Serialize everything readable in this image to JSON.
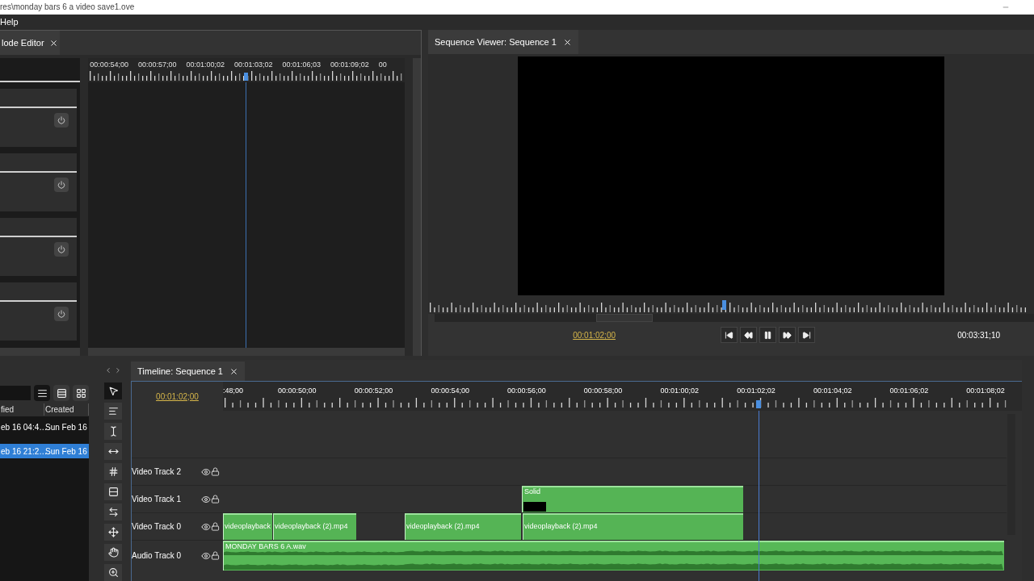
{
  "window": {
    "title": "res\\monday bars 6 a video save1.ove"
  },
  "menu": [
    {
      "label": "Help"
    }
  ],
  "node_editor": {
    "tab": "lode Editor",
    "playhead": {
      "level": 0.5
    },
    "nodes": [
      {
        "kind": "effect"
      },
      {
        "kind": "effect"
      },
      {
        "kind": "effect"
      },
      {
        "kind": "effect"
      }
    ],
    "ruler": [
      "00:00:54;00",
      "00:00:57;00",
      "00:01:00;02",
      "00:01:03;02",
      "00:01:06;03",
      "00:01:09;02",
      "00"
    ]
  },
  "viewer": {
    "tab": "Sequence Viewer: Sequence 1",
    "current_time": "00:01:02;00",
    "duration": "00:03:31;10",
    "transport": [
      {
        "kind": "first"
      },
      {
        "kind": "rewind"
      },
      {
        "kind": "pause"
      },
      {
        "kind": "forward"
      },
      {
        "kind": "last"
      }
    ]
  },
  "media_bin": {
    "columns": [
      "fied",
      "Created"
    ],
    "views": [
      {
        "kind": "list",
        "selected": true
      },
      {
        "kind": "rows",
        "selected": false
      },
      {
        "kind": "grid",
        "selected": false
      }
    ],
    "rows": [
      {
        "cells": [
          "eb 16 04:4…",
          "Sun Feb 16"
        ],
        "selected": false
      },
      {
        "cells": [
          "eb 16 21:2…",
          "Sun Feb 16"
        ],
        "selected": true
      }
    ]
  },
  "tools": [
    {
      "kind": "pointer",
      "selected": true
    },
    {
      "kind": "align",
      "selected": false
    },
    {
      "kind": "ibeam",
      "selected": false
    },
    {
      "kind": "slip",
      "selected": false
    },
    {
      "kind": "grid",
      "selected": false
    },
    {
      "kind": "ripple",
      "selected": false
    },
    {
      "kind": "stretch",
      "selected": false
    },
    {
      "kind": "move",
      "selected": false
    },
    {
      "kind": "hand",
      "selected": false
    },
    {
      "kind": "zoom",
      "selected": false
    }
  ],
  "timeline": {
    "tab": "Timeline: Sequence 1",
    "current_time": "00:01:02;00",
    "ruler": [
      ":48;00",
      "00:00:50;00",
      "00:00:52;00",
      "00:00:54;00",
      "00:00:56;00",
      "00:00:58;00",
      "00:01:00;02",
      "00:01:02;02",
      "00:01:04;02",
      "00:01:06;02",
      "00:01:08;02"
    ],
    "tracks": [
      {
        "name": "Video Track 2",
        "kind": "video"
      },
      {
        "name": "Video Track 1",
        "kind": "video",
        "clips": [
          {
            "kind": "solid",
            "label": "Solid"
          }
        ]
      },
      {
        "name": "Video Track 0",
        "kind": "video",
        "clips": [
          {
            "kind": "video",
            "label": "videoplayback"
          },
          {
            "kind": "video",
            "label": "videoplayback (2).mp4"
          },
          {
            "kind": "video",
            "label": "videoplayback (2).mp4"
          },
          {
            "kind": "video",
            "label": "videoplayback (2).mp4"
          }
        ]
      },
      {
        "name": "Audio Track 0",
        "kind": "audio",
        "clips": [
          {
            "kind": "audio",
            "label": "MONDAY BARS 6 A.wav"
          }
        ]
      }
    ]
  }
}
